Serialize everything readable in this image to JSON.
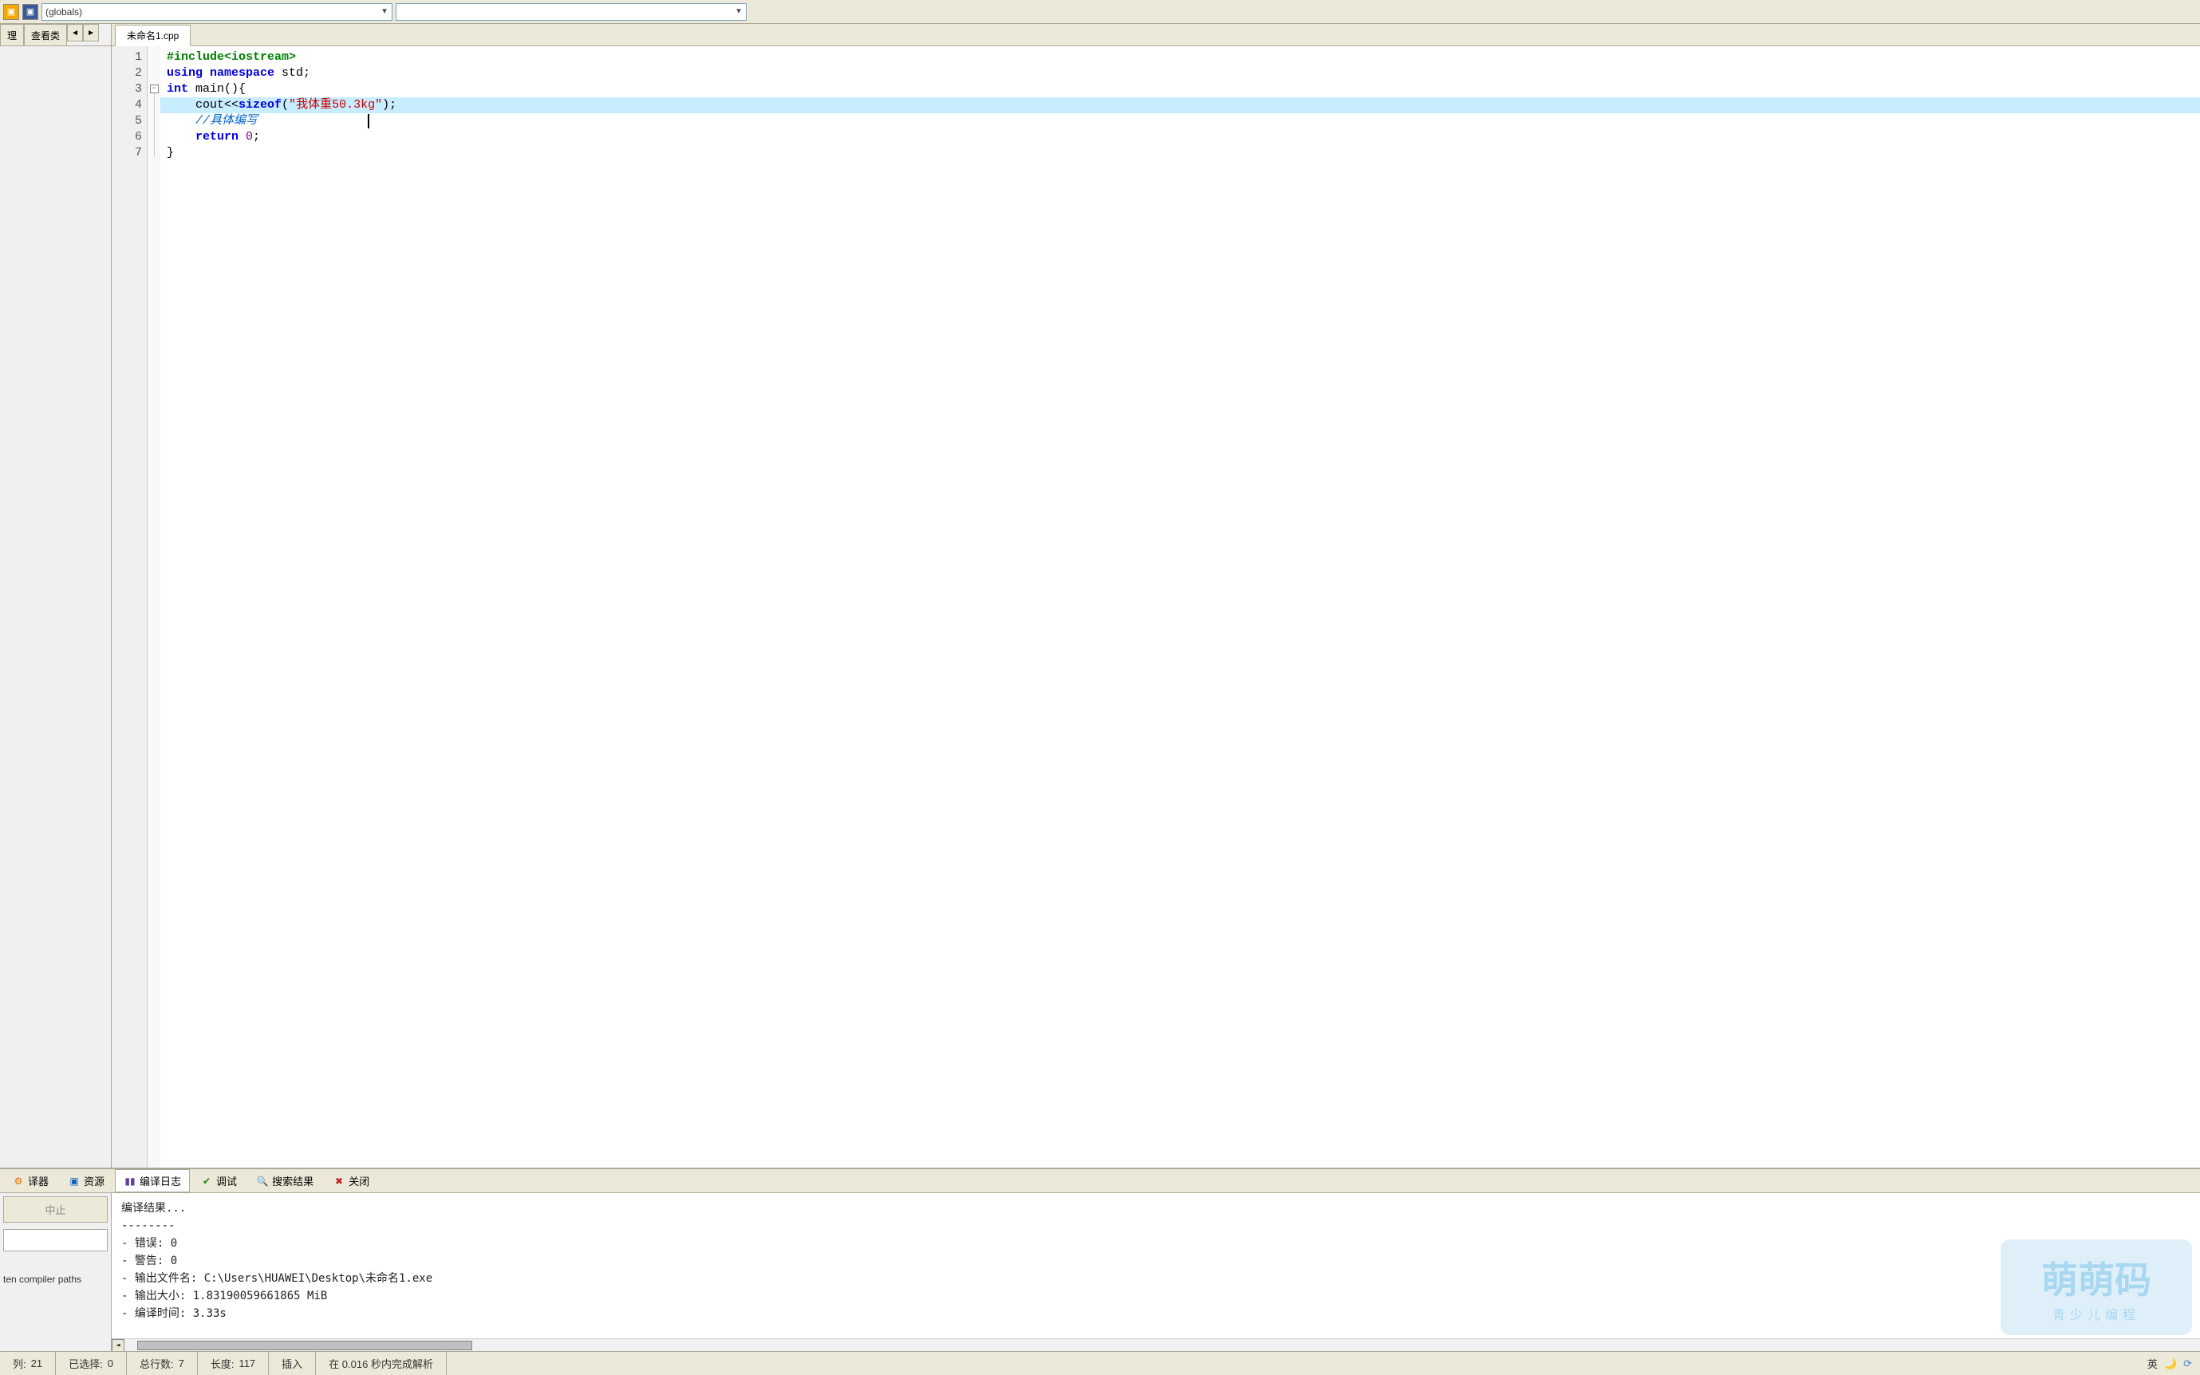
{
  "toolbar": {
    "dropdown1": "(globals)",
    "dropdown2": ""
  },
  "sidebar": {
    "tab1": "理",
    "tab2": "查看类",
    "compiler_paths_label": "ten compiler paths"
  },
  "file_tab": "未命名1.cpp",
  "code_lines": {
    "l1_include": "#include<iostream>",
    "l2_using": "using",
    "l2_namespace": "namespace",
    "l2_std": " std;",
    "l3_int": "int",
    "l3_main": " main(){",
    "l4_indent": "    ",
    "l4_cout": "cout<<",
    "l4_sizeof": "sizeof",
    "l4_open": "(",
    "l4_str": "\"我体重50.3kg\"",
    "l4_close": ");",
    "l5_indent": "    ",
    "l5_comment": "//具体编写",
    "l6_indent": "    ",
    "l6_return": "return",
    "l6_zero": " 0",
    "l6_semi": ";",
    "l7_close": "}"
  },
  "line_numbers": [
    "1",
    "2",
    "3",
    "4",
    "5",
    "6",
    "7"
  ],
  "bottom_tabs": {
    "compiler": "译器",
    "resource": "资源",
    "log": "编译日志",
    "debug": "调试",
    "search": "搜索结果",
    "close": "关闭"
  },
  "abort_button": "中止",
  "output": {
    "header": "编译结果...",
    "sep": "--------",
    "err_label": "- 错误: ",
    "err_val": "0",
    "warn_label": "- 警告: ",
    "warn_val": "0",
    "outfile_label": "- 输出文件名: ",
    "outfile_val": "C:\\Users\\HUAWEI\\Desktop\\未命名1.exe",
    "size_label": "- 输出大小: ",
    "size_val": "1.83190059661865 MiB",
    "time_label": "- 编译时间: ",
    "time_val": "3.33s"
  },
  "statusbar": {
    "col_label": "列:",
    "col_val": "21",
    "sel_label": "已选择:",
    "sel_val": "0",
    "total_label": "总行数:",
    "total_val": "7",
    "len_label": "长度:",
    "len_val": "117",
    "mode": "插入",
    "parse": "在 0.016 秒内完成解析",
    "ime": "英"
  },
  "watermark": {
    "main": "萌萌码",
    "sub": "青少儿编程"
  }
}
